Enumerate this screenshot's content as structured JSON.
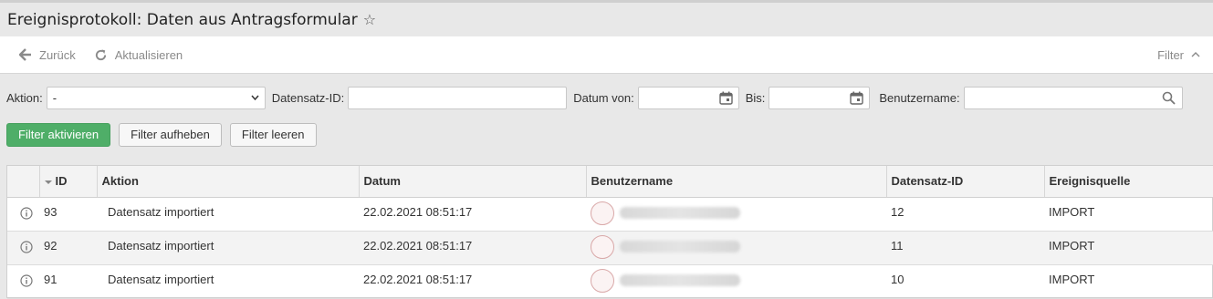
{
  "header": {
    "title": "Ereignisprotokoll: Daten aus Antragsformular",
    "favorite_icon": "star-icon"
  },
  "toolbar": {
    "back_label": "Zurück",
    "refresh_label": "Aktualisieren",
    "filter_label": "Filter"
  },
  "filters": {
    "action_label": "Aktion:",
    "action_value": "-",
    "record_id_label": "Datensatz-ID:",
    "record_id_value": "",
    "date_from_label": "Datum von:",
    "date_from_value": "",
    "date_to_label": "Bis:",
    "date_to_value": "",
    "username_label": "Benutzername:",
    "username_value": ""
  },
  "buttons": {
    "activate": "Filter aktivieren",
    "remove": "Filter aufheben",
    "clear": "Filter leeren"
  },
  "table": {
    "columns": [
      "ID",
      "Aktion",
      "Datum",
      "Benutzername",
      "Datensatz-ID",
      "Ereignisquelle"
    ],
    "rows": [
      {
        "id": "93",
        "action": "Datensatz importiert",
        "date": "22.02.2021 08:51:17",
        "username": "",
        "record_id": "12",
        "source": "IMPORT"
      },
      {
        "id": "92",
        "action": "Datensatz importiert",
        "date": "22.02.2021 08:51:17",
        "username": "",
        "record_id": "11",
        "source": "IMPORT"
      },
      {
        "id": "91",
        "action": "Datensatz importiert",
        "date": "22.02.2021 08:51:17",
        "username": "",
        "record_id": "10",
        "source": "IMPORT"
      }
    ]
  },
  "colors": {
    "primary_button": "#4fae68",
    "header_bg": "#e8e8e8",
    "alt_row": "#f3f3f3"
  }
}
